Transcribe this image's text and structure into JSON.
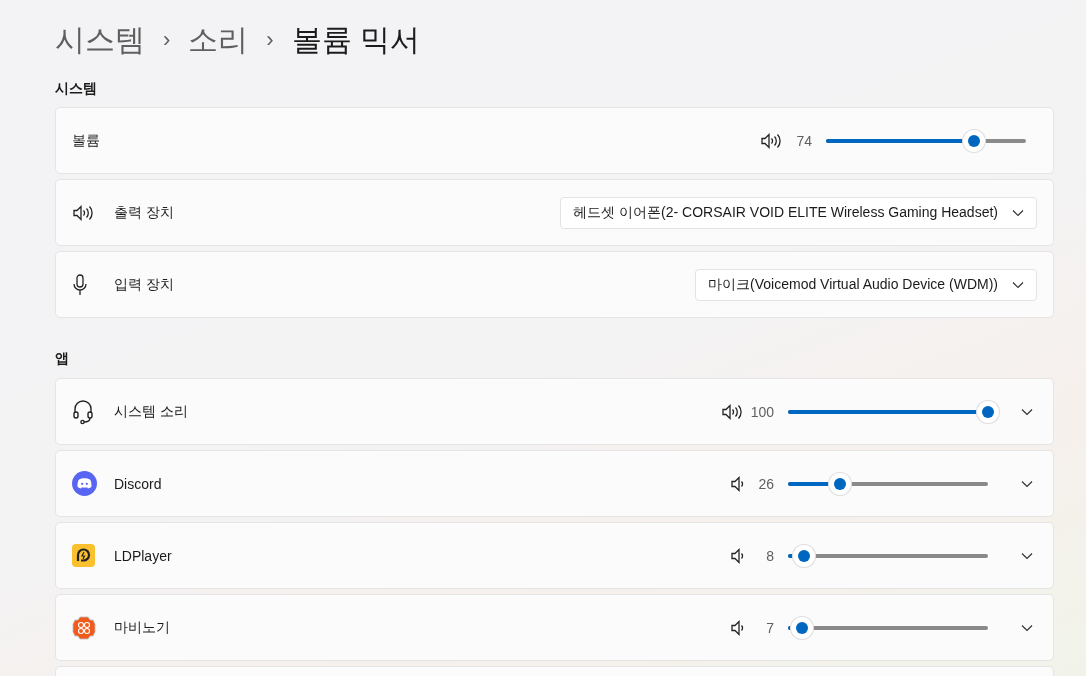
{
  "breadcrumb": [
    {
      "label": "시스템",
      "current": false
    },
    {
      "label": "소리",
      "current": false
    },
    {
      "label": "볼륨 믹서",
      "current": true
    }
  ],
  "breadcrumb_separator": "›",
  "system": {
    "heading": "시스템",
    "volume": {
      "label": "볼륨",
      "reading": "74",
      "level": 0.74
    },
    "devices": [
      {
        "kind": "output",
        "label": "출력 장치",
        "value": "헤드셋 이어폰(2- CORSAIR VOID ELITE Wireless Gaming Headset)"
      },
      {
        "kind": "input",
        "label": "입력 장치",
        "value": "마이크(Voicemod Virtual Audio Device (WDM))"
      }
    ]
  },
  "apps": {
    "heading": "앱",
    "items": [
      {
        "kind": "headset",
        "name": "시스템 소리",
        "reading": "100",
        "level": 1.0
      },
      {
        "kind": "discord",
        "name": "Discord",
        "reading": "26",
        "level": 0.26
      },
      {
        "kind": "ldplayer",
        "name": "LDPlayer",
        "reading": "8",
        "level": 0.08
      },
      {
        "kind": "mabinogi",
        "name": "마비노기",
        "reading": "7",
        "level": 0.07
      }
    ]
  }
}
